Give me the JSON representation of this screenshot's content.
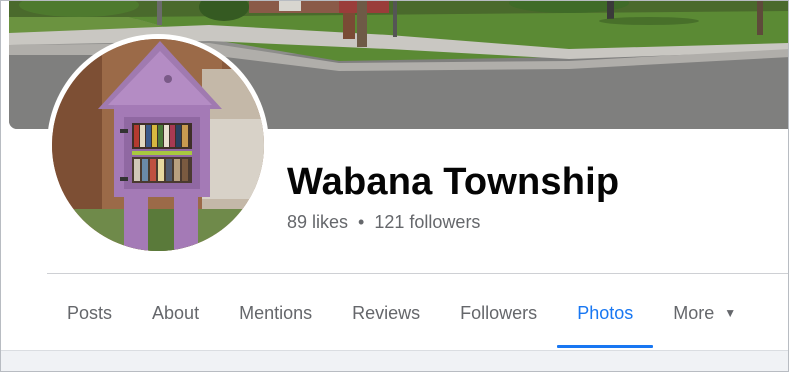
{
  "page": {
    "title": "Wabana Township",
    "likes": "89 likes",
    "separator": "•",
    "followers": "121 followers"
  },
  "tabs": [
    {
      "label": "Posts",
      "active": false
    },
    {
      "label": "About",
      "active": false
    },
    {
      "label": "Mentions",
      "active": false
    },
    {
      "label": "Reviews",
      "active": false
    },
    {
      "label": "Followers",
      "active": false
    },
    {
      "label": "Photos",
      "active": true
    },
    {
      "label": "More",
      "active": false,
      "icon": "caret-down-icon"
    }
  ],
  "colors": {
    "accent": "#1877f2",
    "text_primary": "#050505",
    "text_secondary": "#65676b",
    "little_library": "#9b6bb0"
  }
}
